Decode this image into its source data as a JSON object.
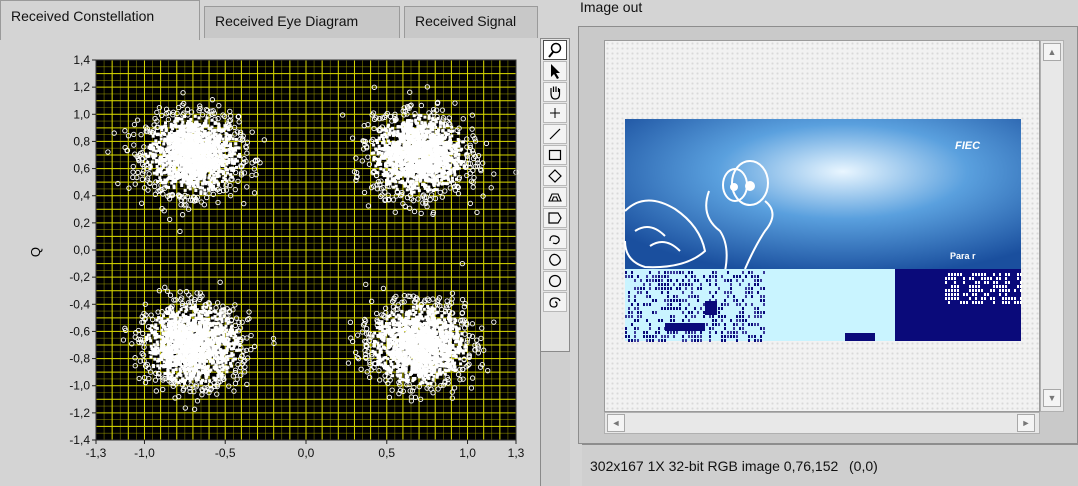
{
  "tabs": [
    {
      "label": "Received Constellation",
      "active": true
    },
    {
      "label": "Received Eye Diagram",
      "active": false
    },
    {
      "label": "Received Signal",
      "active": false
    }
  ],
  "chart_data": {
    "type": "scatter",
    "title": "",
    "ylabel": "Q",
    "xlim": [
      -1.3,
      1.3
    ],
    "ylim": [
      -1.4,
      1.4
    ],
    "x_ticks": [
      "-1,3",
      "-1,0",
      "-0,5",
      "0,0",
      "0,5",
      "1,0",
      "1,3"
    ],
    "x_tick_values": [
      -1.3,
      -1.0,
      -0.5,
      0.0,
      0.5,
      1.0,
      1.3
    ],
    "y_ticks": [
      "1,4",
      "1,2",
      "1,0",
      "0,8",
      "0,6",
      "0,4",
      "0,2",
      "0,0",
      "-0,2",
      "-0,4",
      "-0,6",
      "-0,8",
      "-1,0",
      "-1,2",
      "-1,4"
    ],
    "y_tick_values": [
      1.4,
      1.2,
      1.0,
      0.8,
      0.6,
      0.4,
      0.2,
      0.0,
      -0.2,
      -0.4,
      -0.6,
      -0.8,
      -1.0,
      -1.2,
      -1.4
    ],
    "grid": true,
    "background": "#000000",
    "grid_color": "#9a9a00",
    "point_color": "#ffffff",
    "series": [
      {
        "name": "",
        "center": [
          -0.7,
          0.7
        ],
        "spread": 0.14
      },
      {
        "name": "",
        "center": [
          0.7,
          0.7
        ],
        "spread": 0.14
      },
      {
        "name": "",
        "center": [
          -0.7,
          -0.7
        ],
        "spread": 0.14
      },
      {
        "name": "",
        "center": [
          0.7,
          -0.7
        ],
        "spread": 0.14
      }
    ]
  },
  "tools": [
    {
      "name": "zoom-icon",
      "selected": true
    },
    {
      "name": "pointer-icon"
    },
    {
      "name": "pan-hand-icon"
    },
    {
      "name": "point-icon"
    },
    {
      "name": "line-icon"
    },
    {
      "name": "rectangle-icon"
    },
    {
      "name": "rotated-rectangle-icon"
    },
    {
      "name": "annulus-icon"
    },
    {
      "name": "broken-line-icon"
    },
    {
      "name": "freehand-icon"
    },
    {
      "name": "polygon-icon"
    },
    {
      "name": "oval-icon"
    },
    {
      "name": "spiral-icon"
    }
  ],
  "image_display": {
    "label": "Image out",
    "logo_text": "FIEC",
    "overlay_text": "Para r",
    "status": "302x167 1X 32-bit RGB image 0,76,152",
    "coords": "(0,0)"
  },
  "colors": {
    "image_blue": "#1f5fae",
    "image_navy": "#0a0a7a",
    "image_cyan": "#c9f4ff"
  }
}
